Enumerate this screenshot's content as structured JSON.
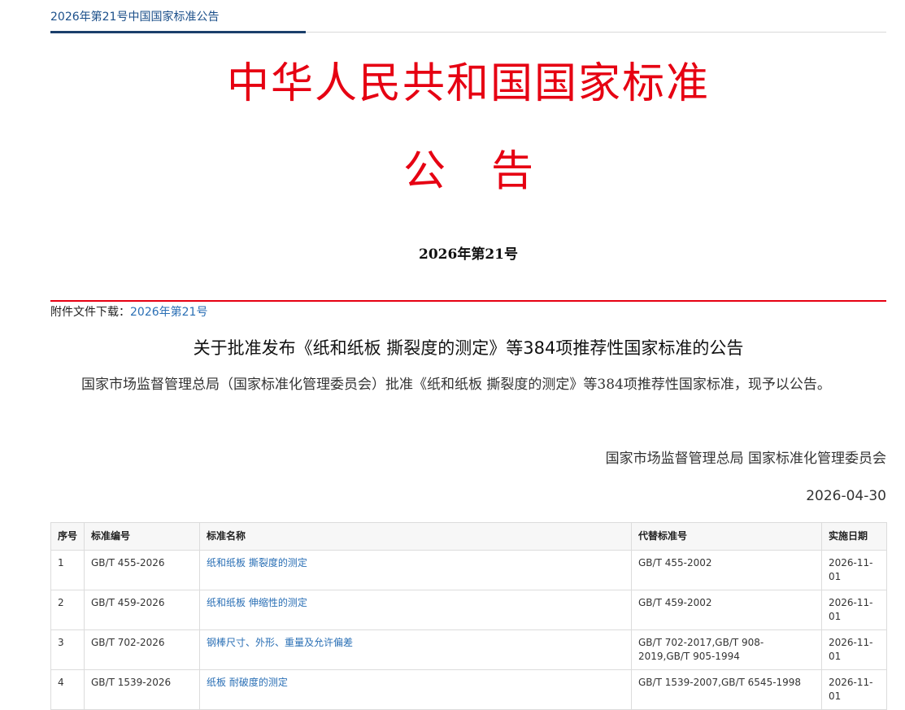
{
  "breadcrumb": {
    "title": "2026年第21号中国国家标准公告"
  },
  "masthead": {
    "line1": "中华人民共和国国家标准",
    "notice_char1": "公",
    "notice_char2": "告"
  },
  "issue_number": "2026年第21号",
  "attachment": {
    "label": "附件文件下载：",
    "link": "2026年第21号"
  },
  "announcement": {
    "title": "关于批准发布《纸和纸板 撕裂度的测定》等384项推荐性国家标准的公告",
    "body": "国家市场监督管理总局（国家标准化管理委员会）批准《纸和纸板 撕裂度的测定》等384项推荐性国家标准，现予以公告。",
    "issuer": "国家市场监督管理总局 国家标准化管理委员会",
    "date": "2026-04-30"
  },
  "colors": {
    "masthead_red": "#e60012",
    "link_blue": "#2a6fb5",
    "nav_blue": "#1b3f6b"
  },
  "table": {
    "headers": [
      "序号",
      "标准编号",
      "标准名称",
      "代替标准号",
      "实施日期"
    ],
    "rows": [
      {
        "no": "1",
        "code": "GB/T 455-2026",
        "name": "纸和纸板 撕裂度的测定",
        "replaces": "GB/T 455-2002",
        "date": "2026-11-01"
      },
      {
        "no": "2",
        "code": "GB/T 459-2026",
        "name": "纸和纸板 伸缩性的测定",
        "replaces": "GB/T 459-2002",
        "date": "2026-11-01"
      },
      {
        "no": "3",
        "code": "GB/T 702-2026",
        "name": "钢棒尺寸、外形、重量及允许偏差",
        "replaces": "GB/T 702-2017,GB/T 908-2019,GB/T 905-1994",
        "date": "2026-11-01"
      },
      {
        "no": "4",
        "code": "GB/T 1539-2026",
        "name": "纸板 耐破度的测定",
        "replaces": "GB/T 1539-2007,GB/T 6545-1998",
        "date": "2026-11-01"
      }
    ]
  }
}
